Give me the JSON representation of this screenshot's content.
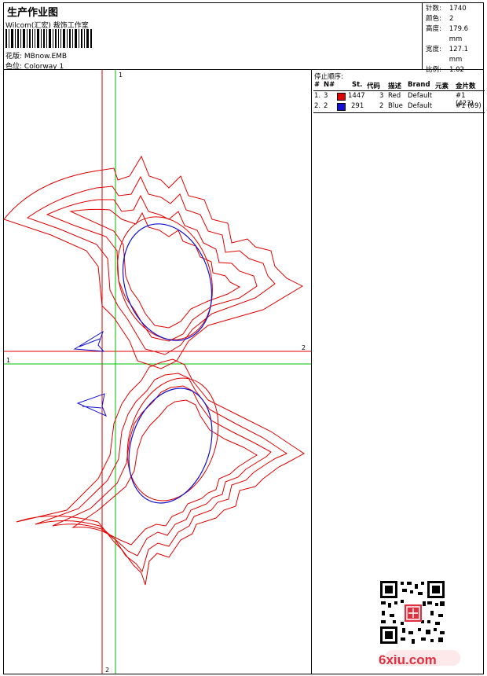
{
  "header": {
    "title": "生产作业图",
    "studio": "Wilcom(汇宏) 裁饰工作室",
    "design_label": "花版:",
    "design_value": "MBnow.EMB",
    "colorway_label": "色位:",
    "colorway_value": "Colorway 1"
  },
  "specs": [
    {
      "label": "针数:",
      "value": "1740"
    },
    {
      "label": "颜色:",
      "value": "2"
    },
    {
      "label": "高度:",
      "value": "179.6 mm"
    },
    {
      "label": "宽度:",
      "value": "127.1 mm"
    },
    {
      "label": "比例:",
      "value": "1.02"
    }
  ],
  "stop_sequence": {
    "caption": "停止顺序:",
    "columns": [
      "#",
      "N#",
      "St.",
      "代码",
      "描述",
      "Brand",
      "元素",
      "金片数"
    ],
    "rows": [
      {
        "num": "1.",
        "needle": "3",
        "color": "#e00000",
        "stitches": "1447",
        "code": "3",
        "desc": "Red",
        "brand": "Default",
        "element": "#1 (423)"
      },
      {
        "num": "2.",
        "needle": "2",
        "color": "#1010d0",
        "stitches": "291",
        "code": "2",
        "desc": "Blue",
        "brand": "Default",
        "element": "#1 (69)"
      }
    ]
  },
  "guides": {
    "red_label_top": "1",
    "red_label_right": "2",
    "green_label_left": "1",
    "green_label_bottom": "2"
  },
  "colors": {
    "red": "#e00000",
    "blue": "#1010d0",
    "green": "#00c000",
    "logo_red": "#e03040"
  },
  "watermark": "6xiu.com"
}
